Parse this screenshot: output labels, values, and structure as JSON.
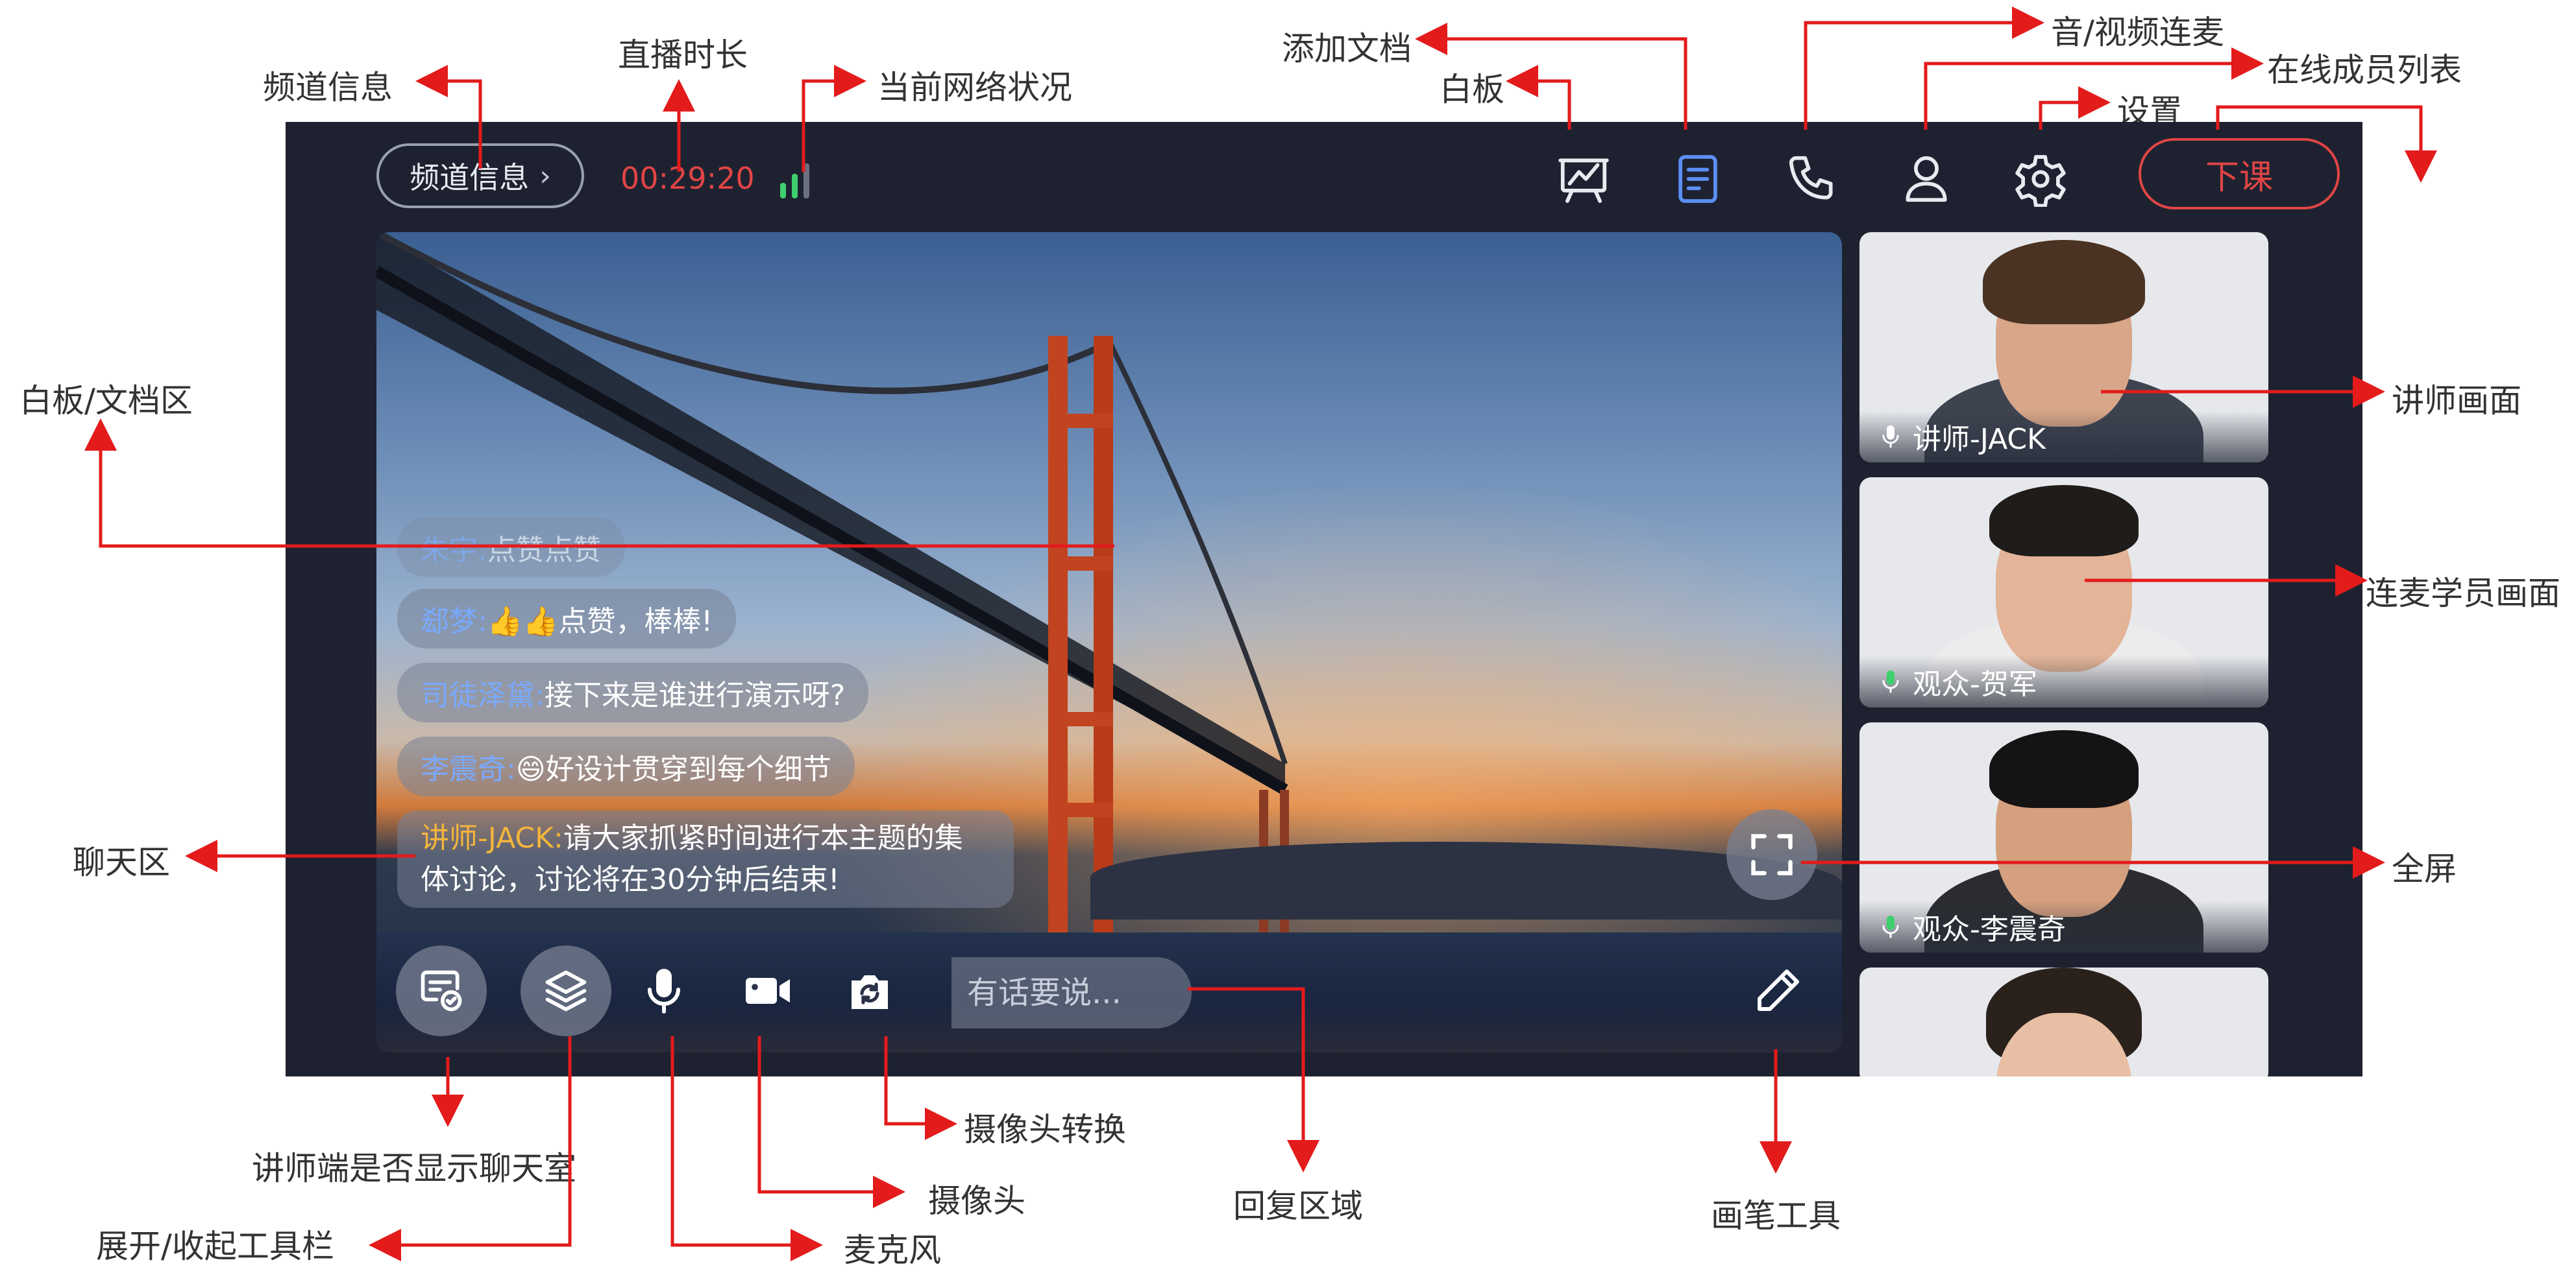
{
  "annotations": {
    "channel_info": "频道信息",
    "live_duration": "直播时长",
    "network_status": "当前网络状况",
    "add_doc": "添加文档",
    "whiteboard": "白板",
    "av_connect": "音/视频连麦",
    "online_members": "在线成员列表",
    "settings": "设置",
    "whiteboard_doc_area": "白板/文档区",
    "teacher_view": "讲师画面",
    "student_view": "连麦学员画面",
    "chat_area": "聊天区",
    "fullscreen": "全屏",
    "show_chat": "讲师端是否显示聊天室",
    "toggle_toolbar": "展开/收起工具栏",
    "microphone": "麦克风",
    "camera": "摄像头",
    "camera_switch": "摄像头转换",
    "reply_area": "回复区域",
    "pen_tool": "画笔工具"
  },
  "topbar": {
    "channel_label": "频道信息",
    "duration": "00:29:20",
    "end_class": "下课",
    "icons": [
      "whiteboard-icon",
      "document-icon",
      "phone-icon",
      "user-icon",
      "gear-icon"
    ]
  },
  "chat": [
    {
      "name": "朱宇:",
      "text": "点赞点赞"
    },
    {
      "name": "郄梦:",
      "text": "👍👍点赞，棒棒!"
    },
    {
      "name": "司徒泽黛:",
      "text": "接下来是谁进行演示呀?"
    },
    {
      "name": "李震奇:",
      "text": "😄好设计贯穿到每个细节"
    },
    {
      "name": "讲师-JACK:",
      "text": "请大家抓紧时间进行本主题的集体讨论，讨论将在30分钟后结束!"
    }
  ],
  "input": {
    "placeholder": "有话要说..."
  },
  "tiles": [
    {
      "label": "讲师-JACK",
      "mic_color": "#ffffff"
    },
    {
      "label": "观众-贺军",
      "mic_color": "#3ecf6e"
    },
    {
      "label": "观众-李震奇",
      "mic_color": "#3ecf6e"
    }
  ],
  "colors": {
    "accent_red": "#e04545",
    "active_blue": "#5b8ff5",
    "signal_green": "#3ecf6e",
    "name_blue": "#79a9ff",
    "teacher_gold": "#f3b53b"
  }
}
